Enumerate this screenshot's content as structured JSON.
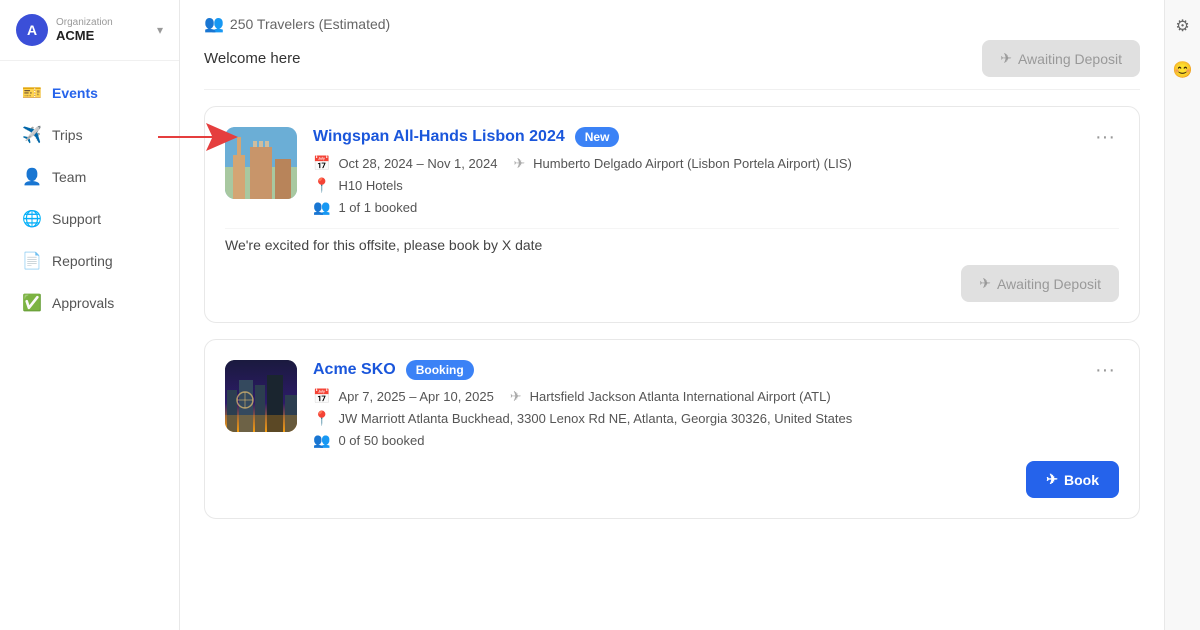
{
  "org": {
    "letter": "A",
    "label": "Organization",
    "name": "ACME"
  },
  "nav": {
    "items": [
      {
        "id": "events",
        "label": "Events",
        "icon": "🎫",
        "active": true
      },
      {
        "id": "trips",
        "label": "Trips",
        "icon": "✈️",
        "active": false
      },
      {
        "id": "team",
        "label": "Team",
        "icon": "👤",
        "active": false
      },
      {
        "id": "support",
        "label": "Support",
        "icon": "🌐",
        "active": false
      },
      {
        "id": "reporting",
        "label": "Reporting",
        "icon": "📄",
        "active": false
      },
      {
        "id": "approvals",
        "label": "Approvals",
        "icon": "✅",
        "active": false
      }
    ]
  },
  "header": {
    "travelers_count": "250 Travelers (Estimated)",
    "welcome_text": "Welcome here"
  },
  "awaiting_deposit_label": "Awaiting Deposit",
  "events": [
    {
      "id": "wingspan",
      "title": "Wingspan All-Hands Lisbon 2024",
      "badge": "New",
      "badge_type": "new",
      "dates": "Oct 28, 2024 – Nov 1, 2024",
      "airport": "Humberto Delgado Airport (Lisbon Portela Airport) (LIS)",
      "hotel": "H10 Hotels",
      "booked": "1 of 1 booked",
      "description": "We're excited for this offsite, please book by X date",
      "cta": "Awaiting Deposit",
      "cta_type": "awaiting"
    },
    {
      "id": "acmesko",
      "title": "Acme SKO",
      "badge": "Booking",
      "badge_type": "booking",
      "dates": "Apr 7, 2025 – Apr 10, 2025",
      "airport": "Hartsfield Jackson Atlanta International Airport (ATL)",
      "hotel": "JW Marriott Atlanta Buckhead, 3300 Lenox Rd NE, Atlanta, Georgia 30326, United States",
      "booked": "0 of 50 booked",
      "description": "",
      "cta": "Book",
      "cta_type": "book"
    }
  ]
}
